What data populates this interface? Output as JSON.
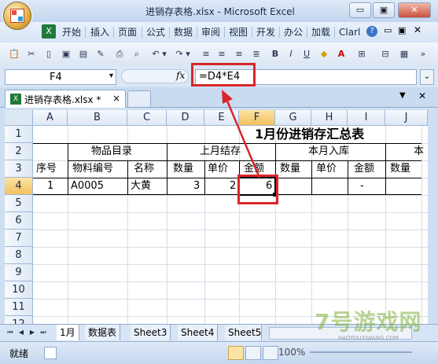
{
  "window": {
    "title": "进销存表格.xlsx - Microsoft Excel",
    "controls": {
      "minimize": "▭",
      "restore": "▣",
      "close": "✕"
    }
  },
  "ribbon_tabs": [
    "开始",
    "插入",
    "页面",
    "公式",
    "数据",
    "审阅",
    "视图",
    "开发",
    "办公",
    "加载",
    "Clarl"
  ],
  "toolbar_icons": [
    "paste-icon",
    "cut-icon",
    "new-icon",
    "save-icon",
    "format-painter-icon",
    "print-icon",
    "print-preview-icon",
    "undo-icon",
    "redo-icon",
    "align-left-icon",
    "align-center-icon",
    "align-right-icon",
    "bold-icon",
    "italic-icon",
    "underline-icon",
    "fill-color-icon",
    "font-color-icon",
    "borders-icon",
    "merge-icon",
    "more-icon"
  ],
  "formula_bar": {
    "name_box": "F4",
    "fx": "fx",
    "formula": "=D4*E4"
  },
  "workbook_tab": {
    "label": "进销存表格.xlsx *",
    "close": "×"
  },
  "grid": {
    "columns": [
      "A",
      "B",
      "C",
      "D",
      "E",
      "F",
      "G",
      "H",
      "I",
      "J"
    ],
    "rows": [
      "1",
      "2",
      "3",
      "4",
      "5",
      "6",
      "7",
      "8",
      "9",
      "10",
      "11",
      "12"
    ],
    "selected_cell": "F4",
    "title": "1月份进销存汇总表",
    "group_headers": {
      "catalog": "物品目录",
      "last_month": "上月结存",
      "this_month_in": "本月入库",
      "partial": "本"
    },
    "sub_headers": [
      "序号",
      "物料编号",
      "名称",
      "数量",
      "单价",
      "金额",
      "数量",
      "单价",
      "金额",
      "数量"
    ],
    "row4": {
      "A": "1",
      "B": "A0005",
      "C": "大黄",
      "D": "3",
      "E": "2",
      "F": "6",
      "I": "-"
    }
  },
  "sheet_tabs": [
    "1月",
    "数据表",
    "Sheet3",
    "Sheet4",
    "Sheet5"
  ],
  "status": {
    "ready": "就绪",
    "zoom": "100%"
  },
  "watermark": {
    "text": "7号游戏网",
    "sub": "HAOYOUXIWANG.COM"
  },
  "colors": {
    "annotation_red": "#d9262c",
    "selection_header": "#f2c160"
  }
}
